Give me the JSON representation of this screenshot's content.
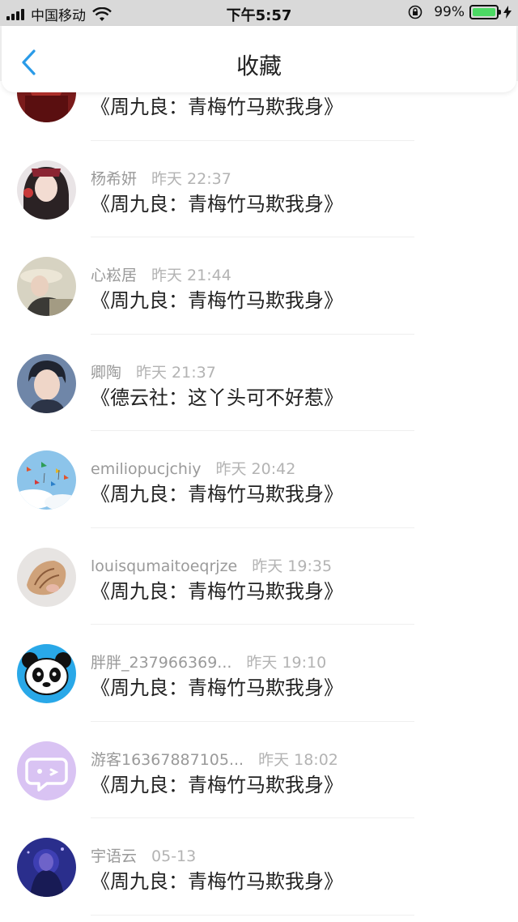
{
  "status_bar": {
    "carrier": "中国移动",
    "time": "下午5:57",
    "battery_percent": "99%",
    "battery_level": 0.99,
    "icons": [
      "signal-icon",
      "wifi-icon",
      "rotation-lock-icon",
      "battery-icon",
      "charging-bolt-icon"
    ]
  },
  "header": {
    "title": "收藏",
    "back_icon": "chevron-left-icon",
    "accent": "#2a9be8"
  },
  "items": [
    {
      "user": "",
      "time": "",
      "title": "《周九良：青梅竹马欺我身》",
      "avatar": "red"
    },
    {
      "user": "杨希妍",
      "time": "昨天 22:37",
      "title": "《周九良：青梅竹马欺我身》",
      "avatar": "girl"
    },
    {
      "user": "心崧居",
      "time": "昨天 21:44",
      "title": "《周九良：青梅竹马欺我身》",
      "avatar": "hat"
    },
    {
      "user": "卿陶",
      "time": "昨天 21:37",
      "title": "《德云社：这丫头可不好惹》",
      "avatar": "boy"
    },
    {
      "user": "emiliopucjchiy",
      "time": "昨天 20:42",
      "title": "《周九良：青梅竹马欺我身》",
      "avatar": "cranes"
    },
    {
      "user": "louisqumaitoeqrjze",
      "time": "昨天 19:35",
      "title": "《周九良：青梅竹马欺我身》",
      "avatar": "shell"
    },
    {
      "user": "胖胖_237966369...",
      "time": "昨天 19:10",
      "title": "《周九良：青梅竹马欺我身》",
      "avatar": "panda"
    },
    {
      "user": "游客16367887105...",
      "time": "昨天 18:02",
      "title": "《周九良：青梅竹马欺我身》",
      "avatar": "chat"
    },
    {
      "user": "宇语云",
      "time": "05-13",
      "title": "《周九良：青梅竹马欺我身》",
      "avatar": "night"
    }
  ]
}
